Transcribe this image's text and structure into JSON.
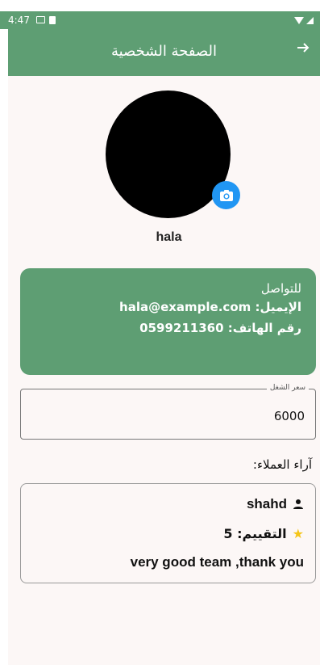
{
  "status_bar": {
    "time": "4:47"
  },
  "app_bar": {
    "title": "الصفحة الشخصية",
    "back_icon": "arrow-right-icon"
  },
  "profile": {
    "username": "hala",
    "camera_icon": "camera-icon"
  },
  "contact": {
    "heading": "للتواصل",
    "email_line": "الإيميل: hala@example.com",
    "phone_line": "رقم الهاتف: 0599211360"
  },
  "price": {
    "label": "سعر الشغل",
    "value": "6000"
  },
  "reviews": {
    "title": "آراء العملاء:",
    "items": [
      {
        "name": "shahd",
        "rating_text": "التقييم: 5",
        "comment": "very good team ,thank you"
      }
    ]
  },
  "colors": {
    "primary": "#5e9e73",
    "accent": "#2196f3",
    "star": "#f5c518"
  }
}
